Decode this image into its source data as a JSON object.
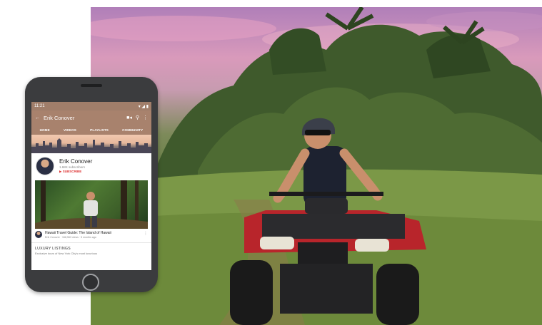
{
  "phone": {
    "status_time": "11:21",
    "status_icons": "▾ ◢ ▮",
    "app_bar": {
      "back_icon": "arrow-left-icon",
      "title": "Erik Conover",
      "camera_icon": "video-camera-icon",
      "search_icon": "search-icon",
      "more_icon": "more-vertical-icon"
    },
    "tabs": [
      "HOME",
      "VIDEOS",
      "PLAYLISTS",
      "COMMUNITY"
    ],
    "channel": {
      "name": "Erik Conover",
      "subscribers": "1.68K subscribers",
      "subscribe_label": "SUBSCRIBE"
    },
    "video": {
      "title": "Hawaii Travel Guide: The Island of Hawaii",
      "meta": "Erik Conover · 348,563 views · 5 months ago"
    },
    "section": {
      "title": "LUXURY LISTINGS",
      "subtitle": "Exclusive tours of New York City's most luxurious"
    }
  },
  "colors": {
    "app_bar": "#a8826d",
    "subscribe": "#dd3333",
    "phone_body": "#3b3c3e"
  }
}
